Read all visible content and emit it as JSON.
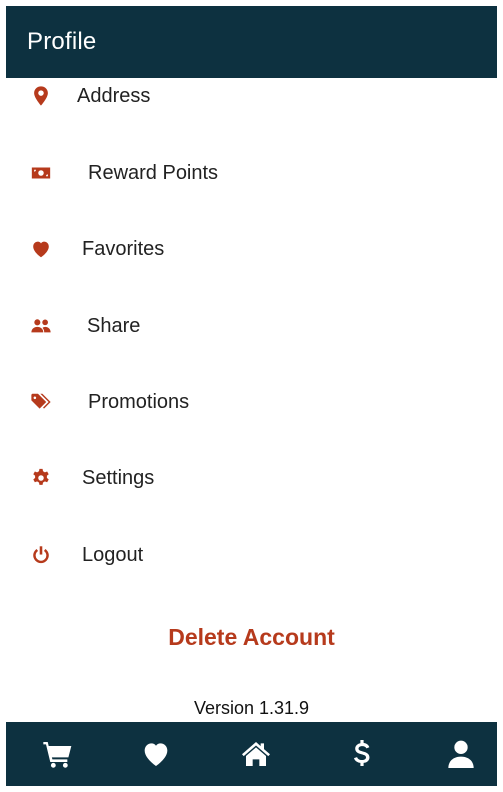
{
  "header": {
    "title": "Profile"
  },
  "menu": {
    "items": [
      {
        "label": "Address",
        "icon": "map-pin-icon"
      },
      {
        "label": "Reward Points",
        "icon": "money-bill-icon"
      },
      {
        "label": "Favorites",
        "icon": "heart-icon"
      },
      {
        "label": "Share",
        "icon": "users-icon"
      },
      {
        "label": "Promotions",
        "icon": "tags-icon"
      },
      {
        "label": "Settings",
        "icon": "gear-icon"
      },
      {
        "label": "Logout",
        "icon": "power-icon"
      }
    ]
  },
  "actions": {
    "delete_label": "Delete Account"
  },
  "footer": {
    "version": "Version 1.31.9"
  },
  "bottom_nav": {
    "items": [
      {
        "icon": "cart-icon"
      },
      {
        "icon": "heart-icon"
      },
      {
        "icon": "home-icon"
      },
      {
        "icon": "dollar-icon"
      },
      {
        "icon": "user-icon"
      }
    ]
  },
  "colors": {
    "primary": "#0d3140",
    "accent": "#b63a1c",
    "background": "#ffffff"
  }
}
